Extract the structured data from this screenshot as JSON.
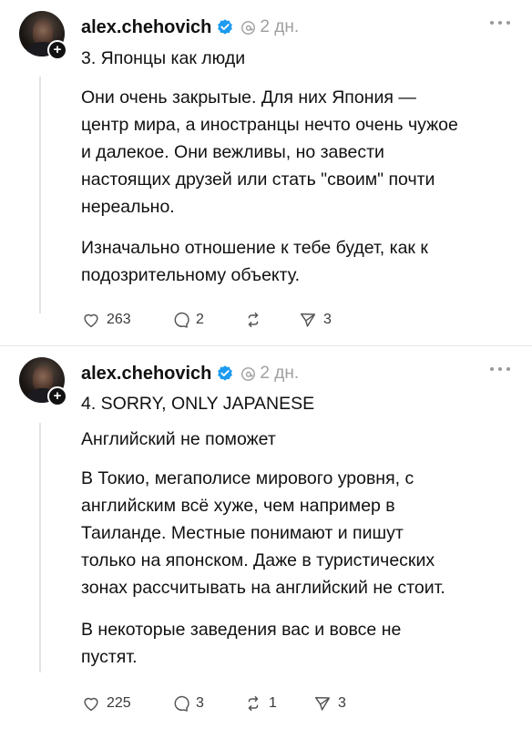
{
  "posts": [
    {
      "author": "alex.chehovich",
      "time": "2 дн.",
      "paragraphs": [
        "3. Японцы как люди",
        "Они очень закрытые. Для них Япония —\nцентр мира, а иностранцы нечто очень чужое\nи далекое. Они вежливы, но завести\nнастоящих друзей или стать \"своим\" почти\nнереально.",
        "Изначально отношение к тебе будет, как к\nподозрительному объекту."
      ],
      "likes": "263",
      "comments": "2",
      "reposts": "",
      "shares": "3"
    },
    {
      "author": "alex.chehovich",
      "time": "2 дн.",
      "paragraphs": [
        "4. SORRY, ONLY JAPANESE",
        "Английский не поможет",
        "В Токио, мегаполисе мирового уровня, с\nанглийским всё хуже, чем например в\nТаиланде. Местные понимают и пишут\nтолько на японском. Даже в туристических\nзонах рассчитывать на английский не стоит.",
        "В некоторые заведения вас и вовсе не\nпустят."
      ],
      "likes": "225",
      "comments": "3",
      "reposts": "1",
      "shares": "3"
    }
  ],
  "icons": {
    "verified": "verified-badge-icon",
    "threads": "threads-logo-icon",
    "more": "more-horizontal-icon",
    "like": "heart-icon",
    "comment": "comment-icon",
    "repost": "repost-icon",
    "share": "send-icon",
    "follow": "plus-icon"
  },
  "colors": {
    "verified": "#1d9bf0",
    "muted": "#a0a0a0",
    "thread_line": "#e3e3e3"
  }
}
